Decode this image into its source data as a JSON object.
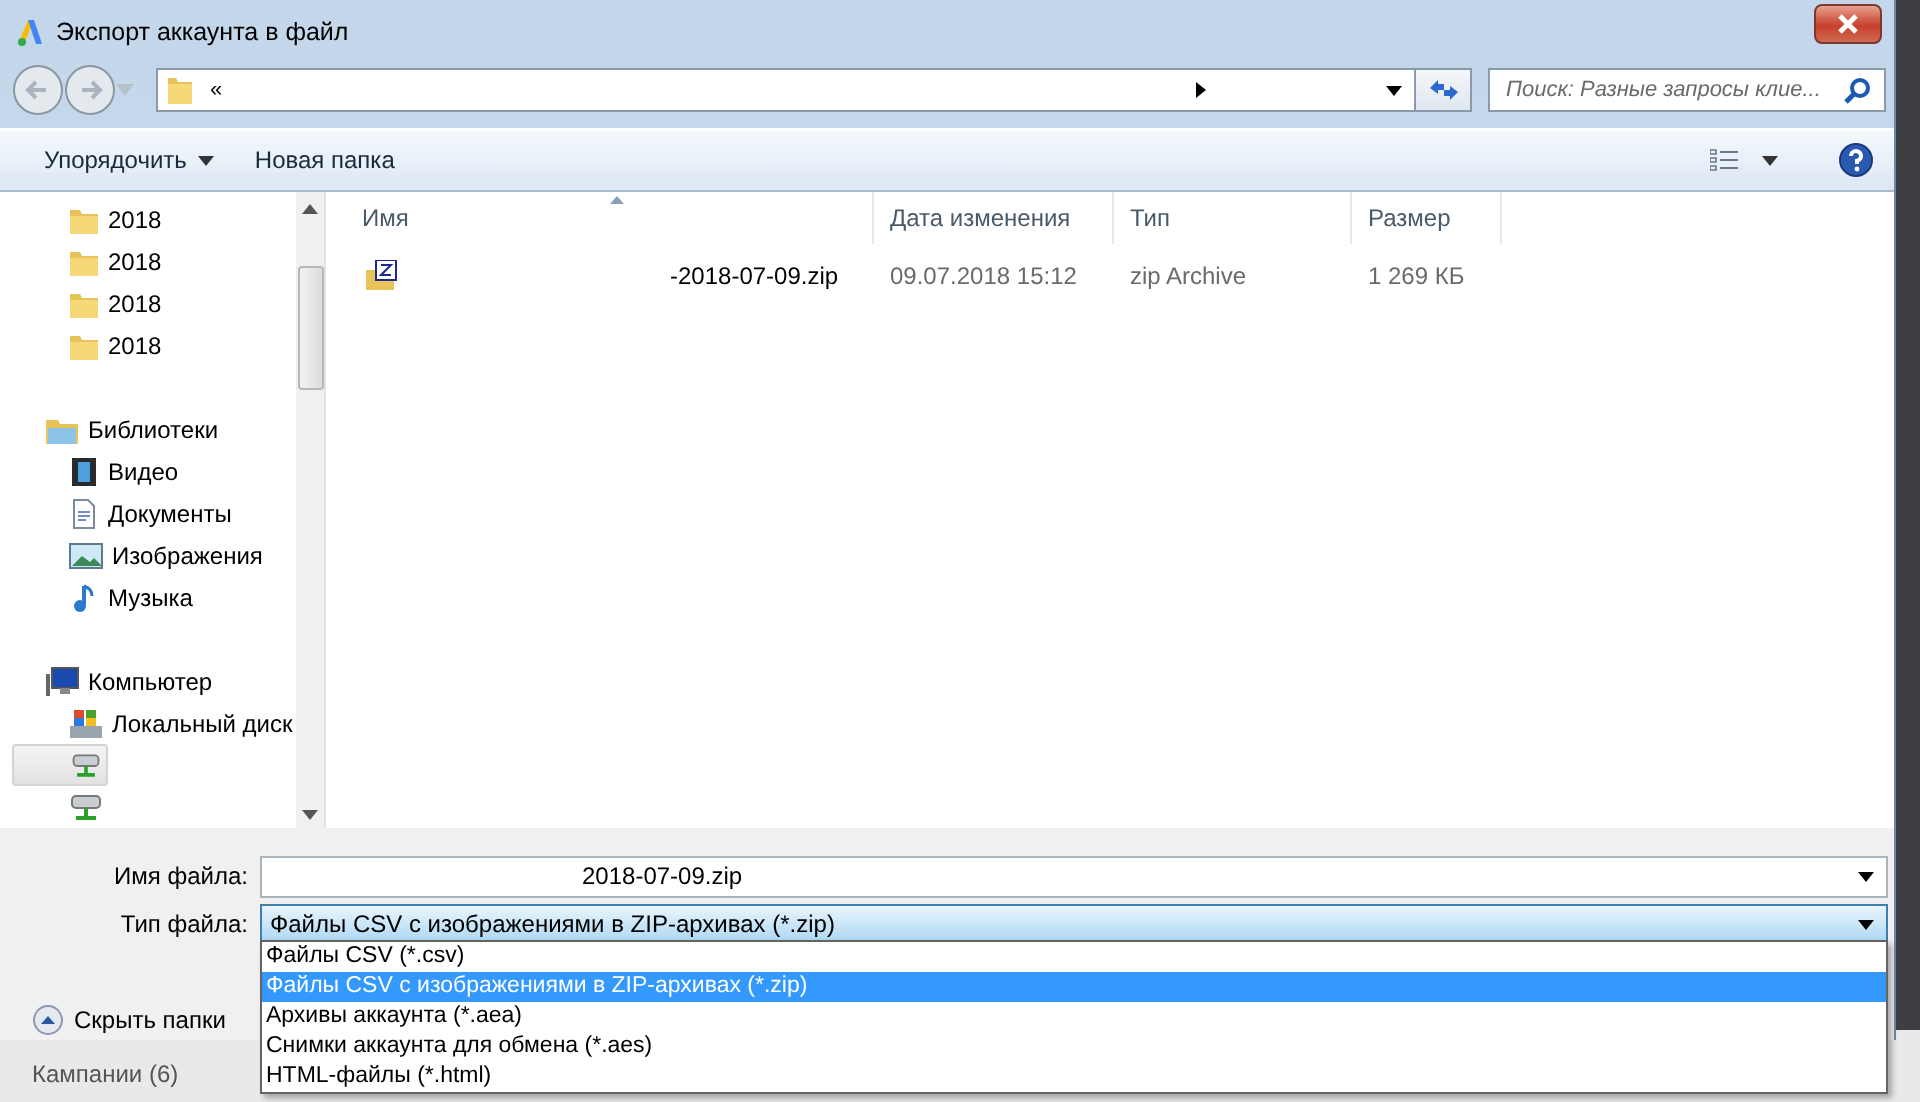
{
  "window": {
    "title": "Экспорт аккаунта в файл"
  },
  "address": {
    "segments": [
      "«"
    ]
  },
  "search": {
    "placeholder": "Поиск: Разные запросы клие..."
  },
  "toolbar": {
    "organize": "Упорядочить",
    "new_folder": "Новая папка"
  },
  "sidebar": {
    "items": [
      {
        "kind": "folder",
        "label": "2018",
        "selected": false
      },
      {
        "kind": "folder",
        "label": "2018",
        "selected": false
      },
      {
        "kind": "folder",
        "label": "2018",
        "selected": false
      },
      {
        "kind": "folder",
        "label": "2018",
        "selected": false
      },
      {
        "kind": "library",
        "label": "Библиотеки",
        "selected": false,
        "children": [
          {
            "kind": "video",
            "label": "Видео",
            "selected": false
          },
          {
            "kind": "documents",
            "label": "Документы",
            "selected": false
          },
          {
            "kind": "images",
            "label": "Изображения",
            "selected": false
          },
          {
            "kind": "music",
            "label": "Музыка",
            "selected": false
          }
        ]
      },
      {
        "kind": "computer",
        "label": "Компьютер",
        "selected": false,
        "children": [
          {
            "kind": "disk",
            "label": "Локальный диск",
            "selected": false
          },
          {
            "kind": "network",
            "selected": true
          },
          {
            "kind": "network",
            "selected": false
          }
        ]
      }
    ]
  },
  "table": {
    "columns": [
      {
        "label": "Имя",
        "sorted": true
      },
      {
        "label": "Дата изменения",
        "sorted": false
      },
      {
        "label": "Тип",
        "sorted": false
      },
      {
        "label": "Размер",
        "sorted": false
      }
    ],
    "rows": [
      {
        "name": "-2018-07-09.zip",
        "date": "09.07.2018 15:12",
        "type": "zip Archive",
        "size": "1 269 КБ"
      }
    ]
  },
  "form": {
    "file_name": {
      "label": "Имя файла:",
      "value": "2018-07-09.zip"
    },
    "file_type": {
      "label": "Тип файла:",
      "value": "Файлы CSV с изображениями в ZIP-архивах (*.zip)",
      "expanded": true,
      "options": [
        {
          "label": "Файлы CSV (*.csv)",
          "selected": false
        },
        {
          "label": "Файлы CSV с изображениями в ZIP-архивах (*.zip)",
          "selected": true
        },
        {
          "label": "Архивы аккаунта (*.aea)",
          "selected": false
        },
        {
          "label": "Снимки аккаунта для обмена (*.aes)",
          "selected": false
        },
        {
          "label": "HTML-файлы (*.html)",
          "selected": false
        }
      ]
    }
  },
  "hide_folders": "Скрыть папки",
  "background": {
    "text": "Кампании (6)"
  }
}
